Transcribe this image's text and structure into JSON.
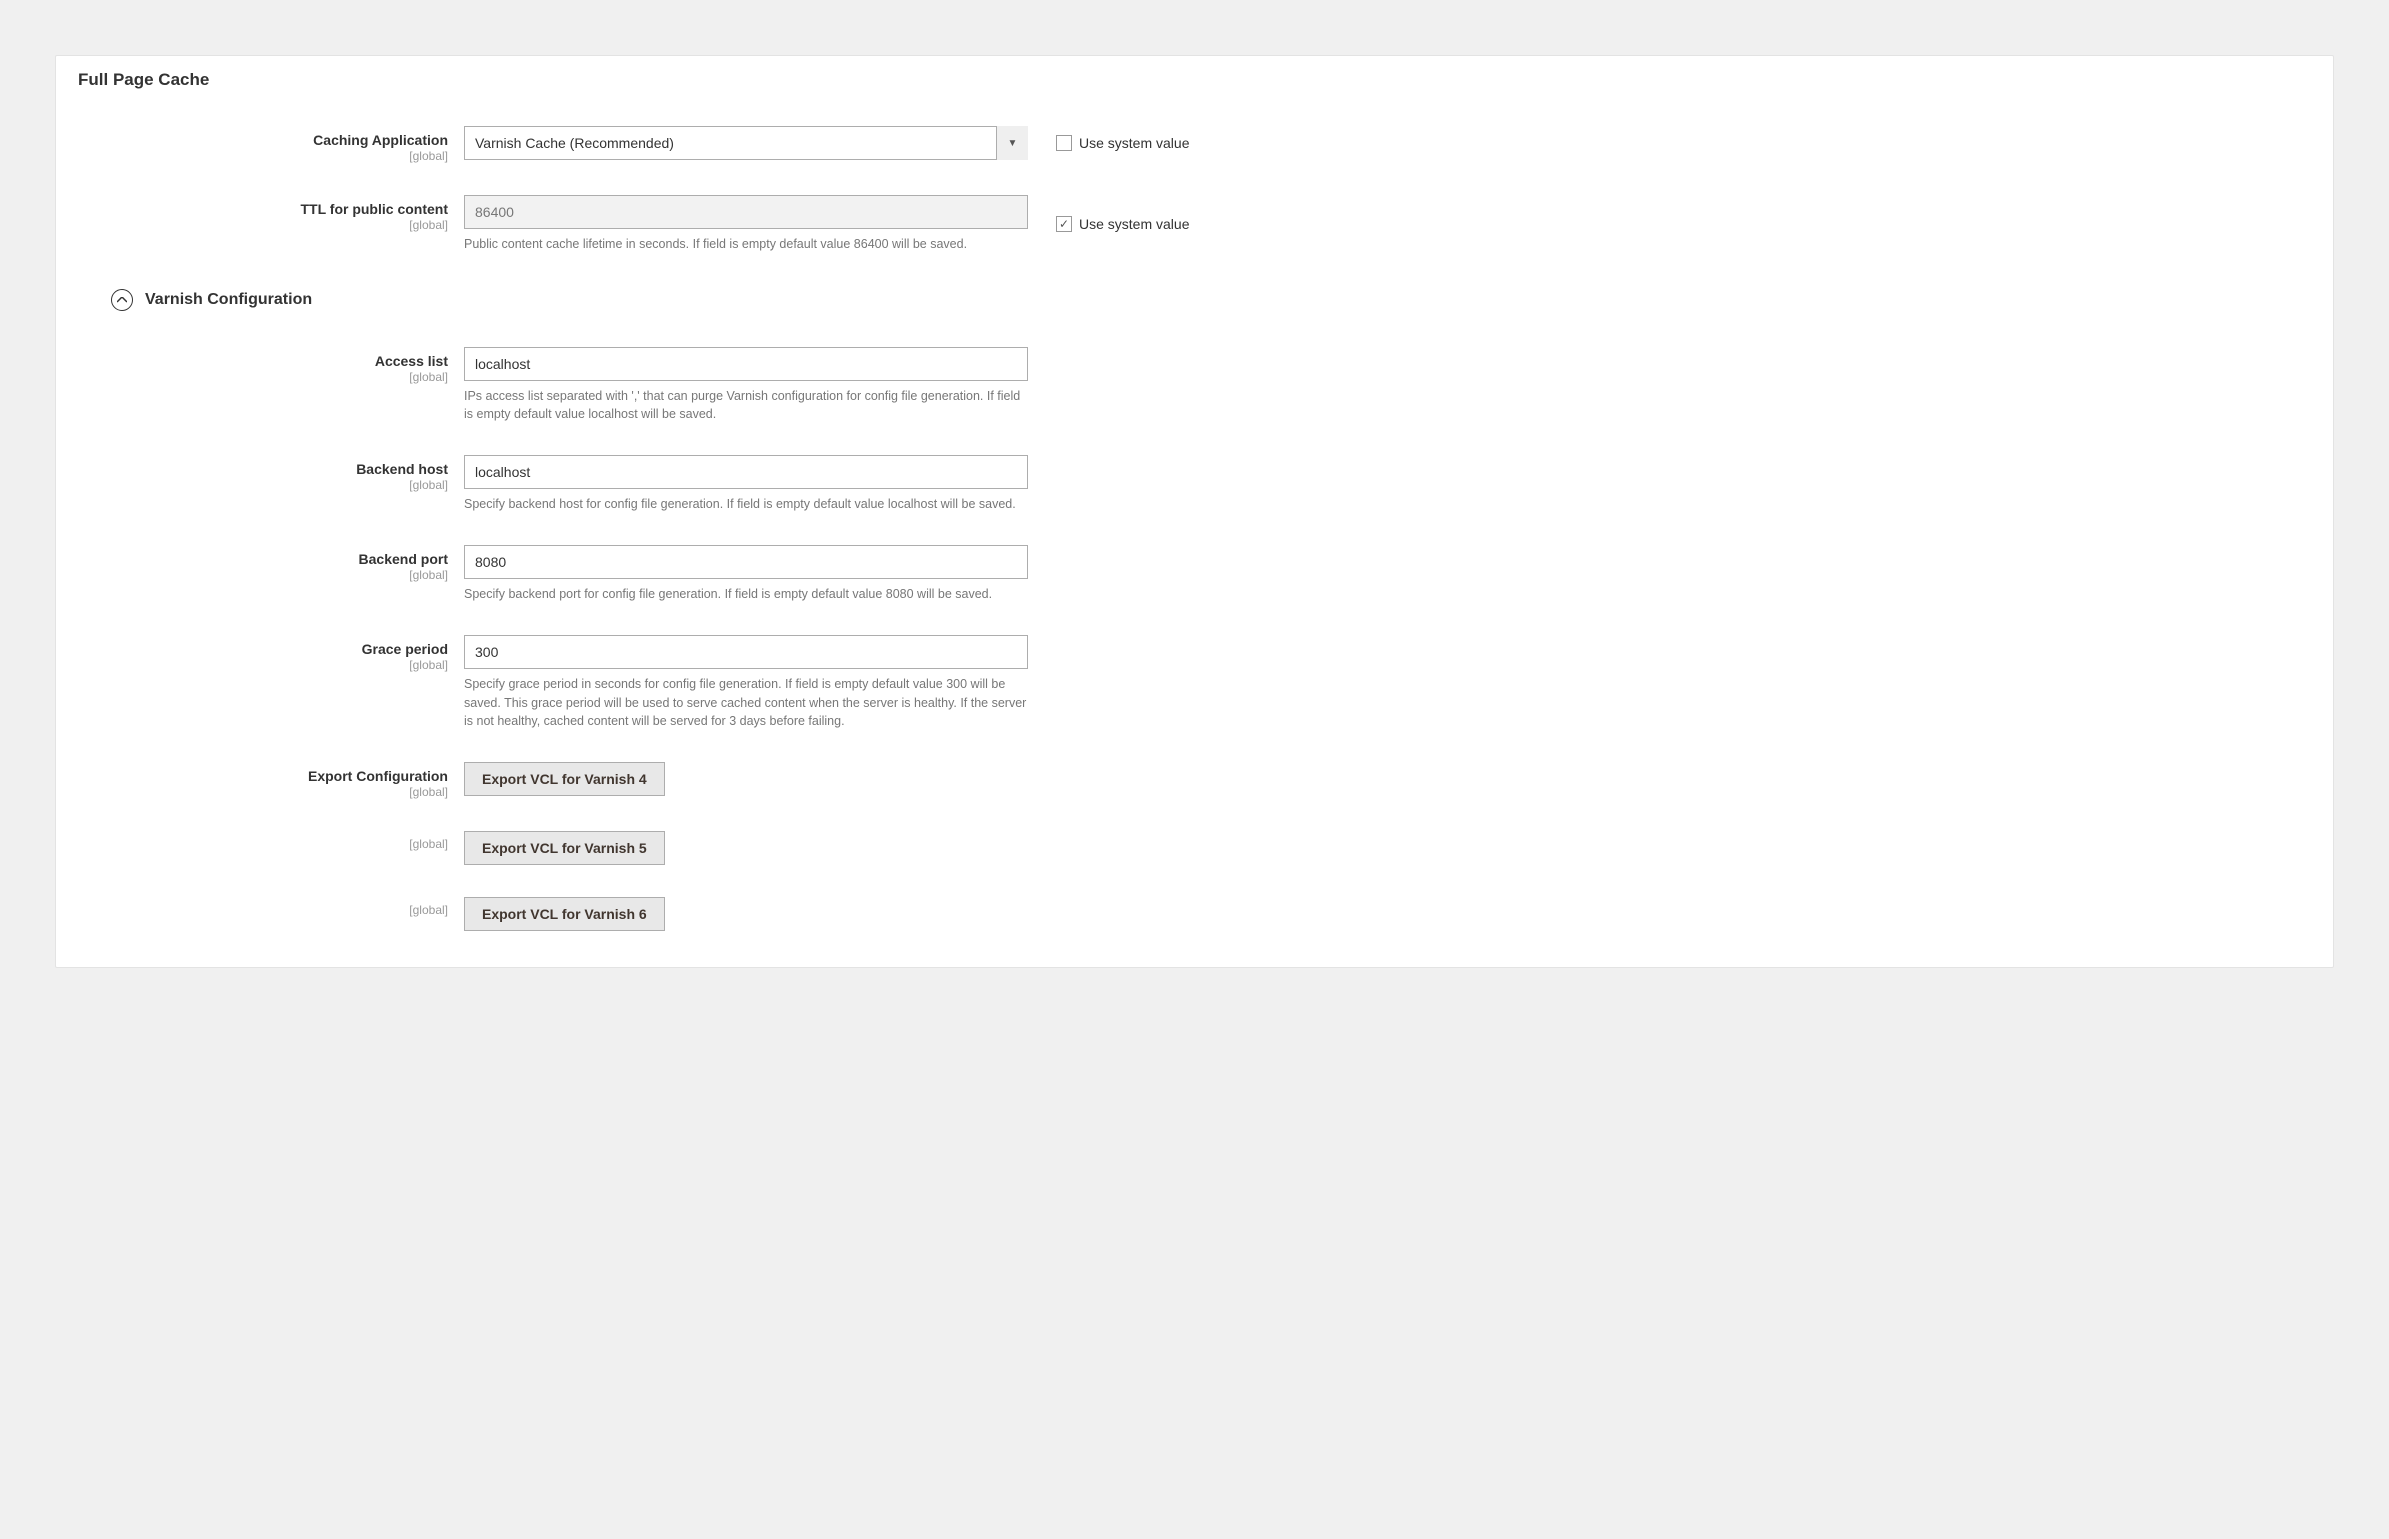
{
  "panel_title": "Full Page Cache",
  "scope_label": "[global]",
  "use_system_value_label": "Use system value",
  "caching_app": {
    "label": "Caching Application",
    "value": "Varnish Cache (Recommended)",
    "use_system": false
  },
  "ttl": {
    "label": "TTL for public content",
    "value": "86400",
    "helper": "Public content cache lifetime in seconds. If field is empty default value 86400 will be saved.",
    "use_system": true
  },
  "section_title": "Varnish Configuration",
  "access_list": {
    "label": "Access list",
    "value": "localhost",
    "helper": "IPs access list separated with ',' that can purge Varnish configuration for config file generation. If field is empty default value localhost will be saved."
  },
  "backend_host": {
    "label": "Backend host",
    "value": "localhost",
    "helper": "Specify backend host for config file generation. If field is empty default value localhost will be saved."
  },
  "backend_port": {
    "label": "Backend port",
    "value": "8080",
    "helper": "Specify backend port for config file generation. If field is empty default value 8080 will be saved."
  },
  "grace_period": {
    "label": "Grace period",
    "value": "300",
    "helper": "Specify grace period in seconds for config file generation. If field is empty default value 300 will be saved. This grace period will be used to serve cached content when the server is healthy. If the server is not healthy, cached content will be served for 3 days before failing."
  },
  "export": {
    "label": "Export Configuration",
    "btn4": "Export VCL for Varnish 4",
    "btn5": "Export VCL for Varnish 5",
    "btn6": "Export VCL for Varnish 6"
  }
}
